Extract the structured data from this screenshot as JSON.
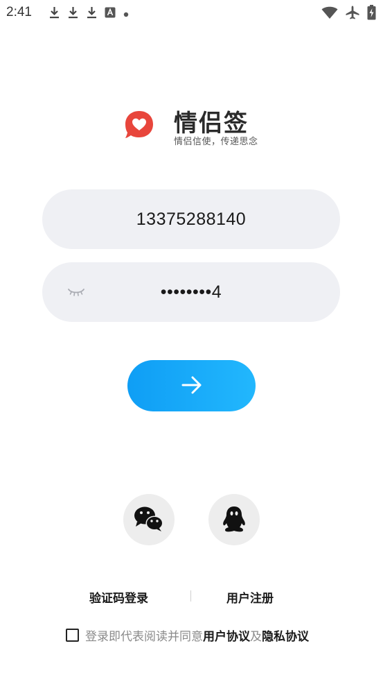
{
  "status_bar": {
    "time": "2:41",
    "left_icons": [
      "download-icon",
      "download-icon",
      "download-icon",
      "text-icon",
      "dot-icon"
    ],
    "right_icons": [
      "wifi-icon",
      "airplane-icon",
      "battery-charging-icon"
    ]
  },
  "app": {
    "title": "情侣签",
    "slogan": "情侣信使，传递思念",
    "brand_color": "#e8463c",
    "logo_icon": "heart-bubble-icon"
  },
  "login_form": {
    "phone_value": "13375288140",
    "password_display": "••••••••4",
    "password_visibility_icon": "closed-eye-icon",
    "submit_icon": "arrow-right-icon",
    "submit_gradient": [
      "#0f9ef5",
      "#22b7fd"
    ]
  },
  "social_login": {
    "wechat_icon": "wechat-icon",
    "qq_icon": "qq-icon"
  },
  "links": {
    "sms_login": "验证码登录",
    "register": "用户注册"
  },
  "agreement": {
    "prefix": "登录即代表阅读并同意",
    "user_agreement": "用户协议",
    "conjunction": "及",
    "privacy_policy": "隐私协议"
  }
}
